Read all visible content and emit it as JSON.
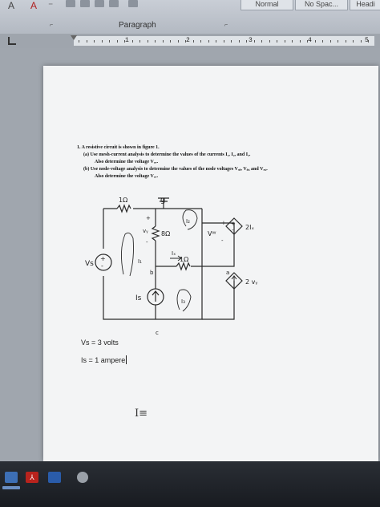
{
  "ribbon": {
    "styles": [
      "Normal",
      "No Spac...",
      "Headi"
    ],
    "group_label": "Paragraph",
    "launcher_glyph": "⌐",
    "left_glyphs": [
      "A",
      "A",
      "⁻"
    ]
  },
  "ruler": {
    "numbers": [
      "1",
      "2",
      "3",
      "4",
      "5"
    ]
  },
  "problem": {
    "line1": "1.  A resistive circuit is shown in figure 1.",
    "line2": "(a)   Use mesh-current analysis to determine the values of the currents  I₁,  I₂,  and  I₃.",
    "line3": "Also determine the  voltage  Vᵤᵥ.",
    "line4": "(b)   Use node-voltage analysis to determine the values of the node voltages  Vₐᵦ,  Vᵦ꜀  and  Vₐ꜀.",
    "line5": "Also determine the  voltage  Vᵤᵥ."
  },
  "circuit": {
    "r1": "1Ω",
    "r2": "8Ω",
    "r3": "1Ω",
    "vs": "Vs",
    "is": "Is",
    "dep_v_label": "2Iₓ",
    "dep_i_label": "2 vᵧ",
    "node_a": "a",
    "node_b": "b",
    "node_c": "c",
    "i1": "I₁",
    "i2": "I₂",
    "i3": "I₃",
    "ix": "Iₓ",
    "vy": "vᵧ",
    "vw": "Vᵂ",
    "plus": "+",
    "minus": "-",
    "ground": "g"
  },
  "given": {
    "vs_value": "Vs = 3 volts",
    "is_value": "Is = 1 ampere"
  },
  "cursor_glyph": "I≡",
  "taskbar": {
    "acrobat_glyph": "⅄"
  }
}
